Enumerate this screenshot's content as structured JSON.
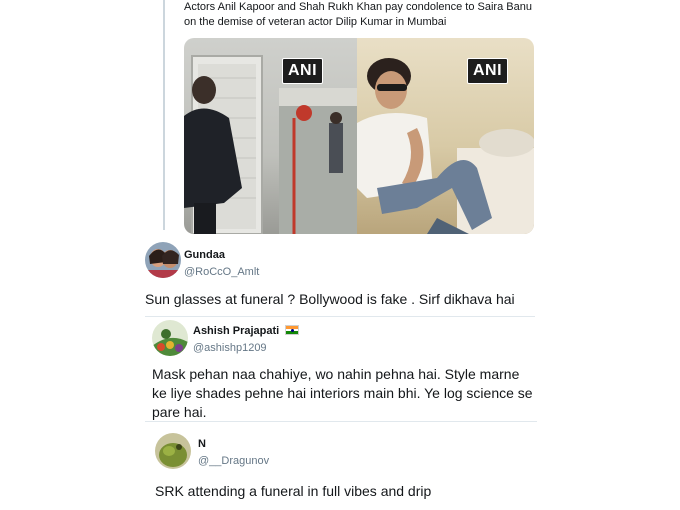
{
  "quoted_tweet": {
    "text": "Actors Anil Kapoor and Shah Rukh Khan pay condolence to Saira Banu on the demise of veteran actor Dilip Kumar in Mumbai",
    "media": [
      {
        "watermark": "ANI"
      },
      {
        "watermark": "ANI"
      }
    ]
  },
  "replies": [
    {
      "name": "Gundaa",
      "handle": "@RoCcO_Amlt",
      "text": "Sun glasses at funeral ? Bollywood is fake . Sirf dikhava hai"
    },
    {
      "name": "Ashish Prajapati",
      "flag": "🇮🇳",
      "handle": "@ashishp1209",
      "text": "Mask pehan naa chahiye, wo nahin pehna hai. Style marne ke liye shades pehne hai interiors main bhi. Ye log science se pare hai."
    },
    {
      "name": "N",
      "handle": "@__Dragunov",
      "text": "SRK attending a funeral in full vibes and drip"
    }
  ],
  "colors": {
    "text_primary": "#14171a",
    "text_secondary": "#657786",
    "separator": "#e1e8ed",
    "flag_saffron": "#ff9933",
    "flag_green": "#138808"
  }
}
